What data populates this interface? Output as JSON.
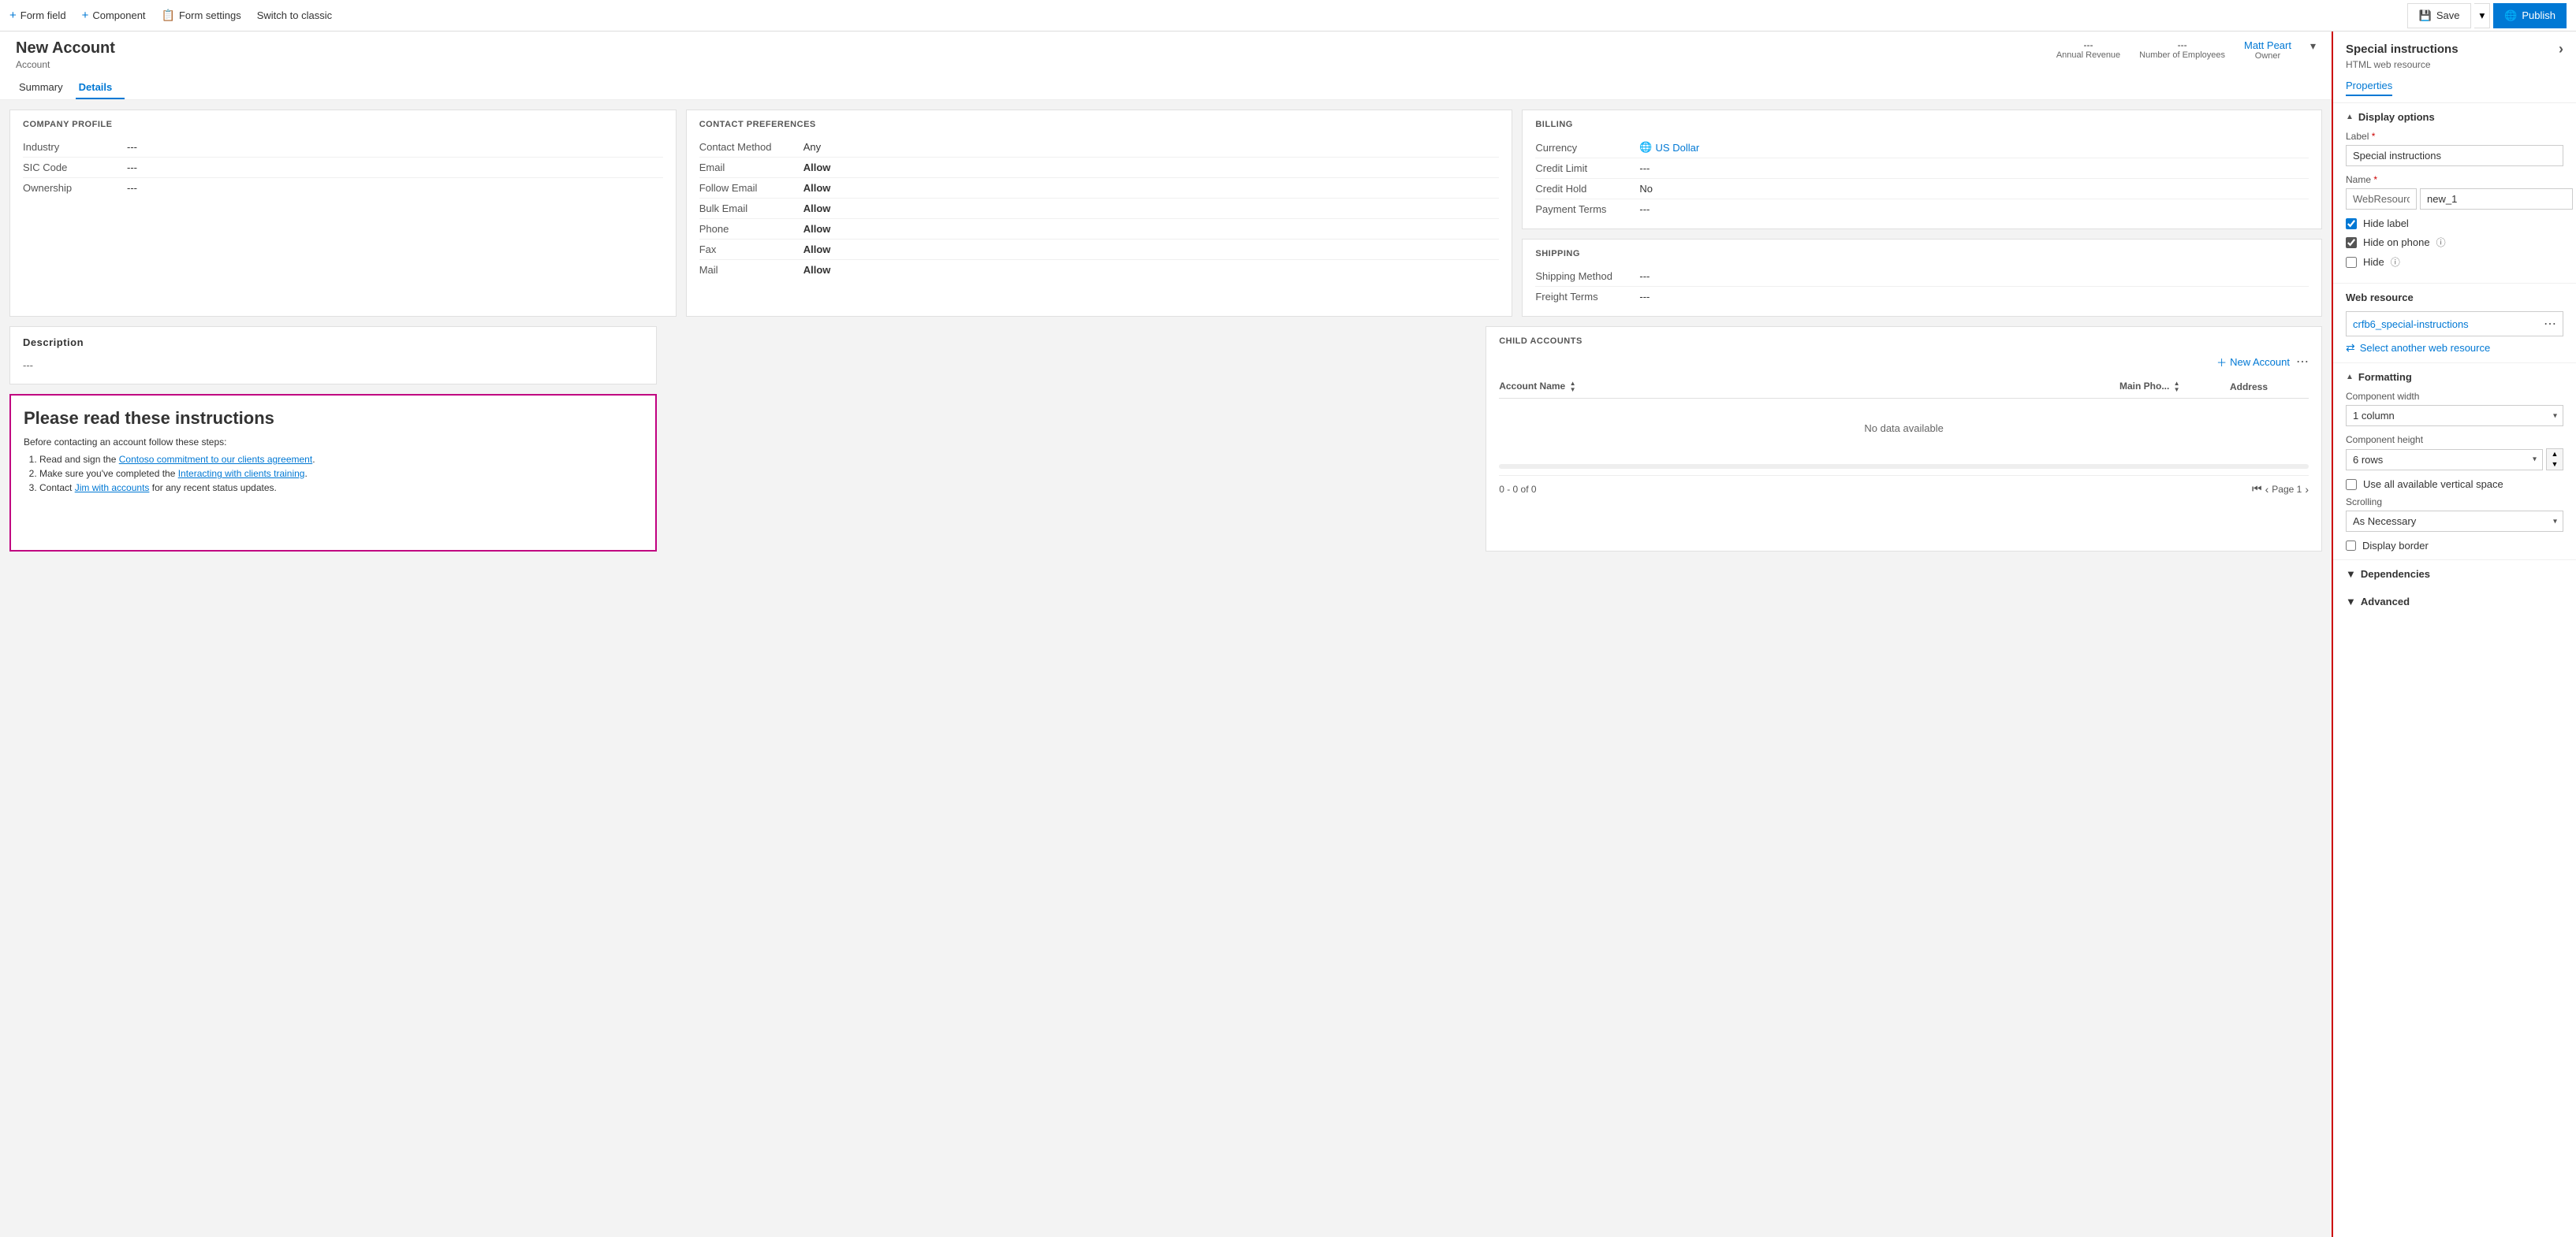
{
  "topbar": {
    "form_field_label": "Form field",
    "component_label": "Component",
    "form_settings_label": "Form settings",
    "switch_label": "Switch to classic",
    "save_label": "Save",
    "publish_label": "Publish"
  },
  "form": {
    "title": "New Account",
    "subtitle": "Account",
    "tabs": [
      "Summary",
      "Details"
    ],
    "active_tab": "Details",
    "header_fields": {
      "annual_revenue_label": "Annual Revenue",
      "annual_revenue_value": "---",
      "employees_label": "Number of Employees",
      "employees_value": "---",
      "owner_label": "Owner",
      "owner_value": "Matt Peart"
    }
  },
  "company_profile": {
    "title": "COMPANY PROFILE",
    "fields": [
      {
        "label": "Industry",
        "value": "---"
      },
      {
        "label": "SIC Code",
        "value": "---"
      },
      {
        "label": "Ownership",
        "value": "---"
      }
    ]
  },
  "description": {
    "label": "Description",
    "value": "---"
  },
  "special_instructions": {
    "heading": "Please read these instructions",
    "intro": "Before contacting an account follow these steps:",
    "steps": [
      {
        "text": "Read and sign the ",
        "link_text": "Contoso commitment to our clients agreement",
        "suffix": "."
      },
      {
        "text": "Make sure you've completed the ",
        "link_text": "Interacting with clients training",
        "suffix": "."
      },
      {
        "text": "Contact ",
        "link_text": "Jim with accounts",
        "suffix": " for any recent status updates."
      }
    ]
  },
  "contact_preferences": {
    "title": "CONTACT PREFERENCES",
    "fields": [
      {
        "label": "Contact Method",
        "value": "Any"
      },
      {
        "label": "Email",
        "value": "Allow"
      },
      {
        "label": "Follow Email",
        "value": "Allow"
      },
      {
        "label": "Bulk Email",
        "value": "Allow"
      },
      {
        "label": "Phone",
        "value": "Allow"
      },
      {
        "label": "Fax",
        "value": "Allow"
      },
      {
        "label": "Mail",
        "value": "Allow"
      }
    ]
  },
  "billing": {
    "title": "BILLING",
    "fields": [
      {
        "label": "Currency",
        "value": "US Dollar",
        "has_icon": true
      },
      {
        "label": "Credit Limit",
        "value": "---"
      },
      {
        "label": "Credit Hold",
        "value": "No"
      },
      {
        "label": "Payment Terms",
        "value": "---"
      }
    ]
  },
  "shipping": {
    "title": "SHIPPING",
    "fields": [
      {
        "label": "Shipping Method",
        "value": "---"
      },
      {
        "label": "Freight Terms",
        "value": "---"
      }
    ]
  },
  "child_accounts": {
    "title": "CHILD ACCOUNTS",
    "new_button": "New Account",
    "columns": [
      "Account Name",
      "Main Pho...",
      "Address"
    ],
    "no_data": "No data available",
    "pagination": {
      "range": "0 - 0 of 0",
      "page": "Page 1"
    }
  },
  "right_panel": {
    "title": "Special instructions",
    "subtitle": "HTML web resource",
    "close_icon": "›",
    "tabs": [
      "Properties"
    ],
    "active_tab": "Properties",
    "display_options": {
      "section_title": "Display options",
      "label_field": {
        "label": "Label",
        "value": "Special instructions"
      },
      "name_field": {
        "label": "Name",
        "prefix": "WebResource_",
        "value": "new_1"
      },
      "hide_label": {
        "label": "Hide label",
        "checked": true
      },
      "hide_on_phone": {
        "label": "Hide on phone",
        "checked": true
      },
      "hide": {
        "label": "Hide",
        "checked": false
      }
    },
    "web_resource": {
      "section_title": "Web resource",
      "resource_name": "crfb6_special-instructions",
      "select_another": "Select another web resource"
    },
    "formatting": {
      "section_title": "Formatting",
      "component_width_label": "Component width",
      "component_width_value": "1 column",
      "component_height_label": "Component height",
      "component_height_value": "6 rows",
      "use_all_space_label": "Use all available vertical space",
      "use_all_space_checked": false,
      "scrolling_label": "Scrolling",
      "scrolling_value": "As Necessary",
      "display_border_label": "Display border",
      "display_border_checked": false
    },
    "dependencies": {
      "section_title": "Dependencies"
    },
    "advanced": {
      "section_title": "Advanced"
    }
  }
}
